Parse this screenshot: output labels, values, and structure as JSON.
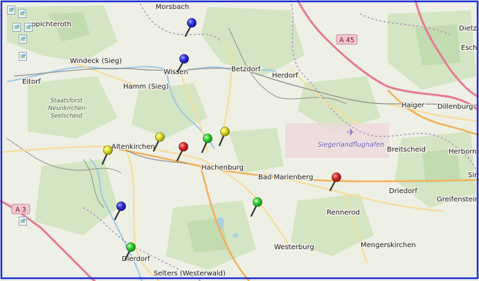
{
  "map": {
    "towns": [
      {
        "id": "morsbach",
        "name": "Morsbach"
      },
      {
        "id": "ruppichteroth",
        "name": "uppichteroth"
      },
      {
        "id": "windeck",
        "name": "Windeck (Sieg)"
      },
      {
        "id": "eitorf",
        "name": "Eitorf"
      },
      {
        "id": "wissen",
        "name": "Wissen"
      },
      {
        "id": "betzdorf",
        "name": "Betzdorf"
      },
      {
        "id": "herdorf",
        "name": "Herdorf"
      },
      {
        "id": "hamm",
        "name": "Hamm (Sieg)"
      },
      {
        "id": "dietz",
        "name": "Dietz"
      },
      {
        "id": "esch",
        "name": "Esch"
      },
      {
        "id": "haiger",
        "name": "Haiger"
      },
      {
        "id": "dillenburg",
        "name": "Dillenburg"
      },
      {
        "id": "altenkirchen",
        "name": "Altenkirchen"
      },
      {
        "id": "hachenburg",
        "name": "Hachenburg"
      },
      {
        "id": "badmarienberg",
        "name": "Bad Marienberg"
      },
      {
        "id": "breitscheid",
        "name": "Breitscheid"
      },
      {
        "id": "herborn",
        "name": "Herborn"
      },
      {
        "id": "sinn",
        "name": "Sin"
      },
      {
        "id": "driedorf",
        "name": "Driedorf"
      },
      {
        "id": "greifenstein",
        "name": "Greifenstein"
      },
      {
        "id": "rennerod",
        "name": "Rennerod"
      },
      {
        "id": "mengerskirchen",
        "name": "Mengerskirchen"
      },
      {
        "id": "westerburg",
        "name": "Westerburg"
      },
      {
        "id": "dierdorf",
        "name": "Dierdorf"
      },
      {
        "id": "selters",
        "name": "Selters (Westerwald)"
      }
    ],
    "forest_label": [
      "Staatsforst",
      "Neunkirchen-",
      "Seelscheid"
    ],
    "airport_label": "Siegerlandflughafen",
    "road_shields": [
      {
        "id": "a45",
        "text": "A 45"
      },
      {
        "id": "a3",
        "text": "A 3"
      }
    ],
    "markers": [
      {
        "id": "m1",
        "color": "blue"
      },
      {
        "id": "m2",
        "color": "blue"
      },
      {
        "id": "m3",
        "color": "yellow"
      },
      {
        "id": "m4",
        "color": "yellow"
      },
      {
        "id": "m5",
        "color": "yellow"
      },
      {
        "id": "m6",
        "color": "red"
      },
      {
        "id": "m7",
        "color": "green"
      },
      {
        "id": "m8",
        "color": "green"
      },
      {
        "id": "m9",
        "color": "blue"
      },
      {
        "id": "m10",
        "color": "green"
      },
      {
        "id": "m11",
        "color": "red"
      }
    ],
    "colors": {
      "frame": "#1f2fd6",
      "blue": "#2b2bd6",
      "yellow": "#d6d61e",
      "red": "#d61e1e",
      "green": "#2ec42e",
      "motorway": "#e8788a",
      "primary_road": "#f2c06a",
      "water": "#9ec8e8",
      "forest": "#cfe3bf"
    }
  }
}
